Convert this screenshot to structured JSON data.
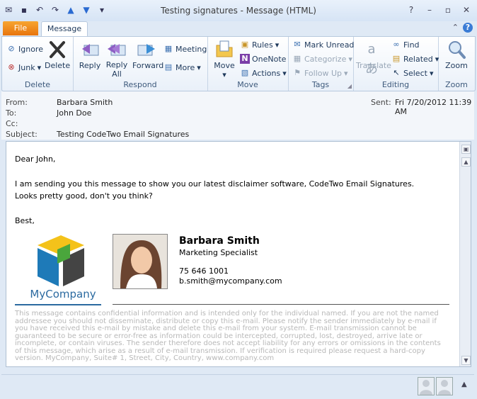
{
  "window": {
    "title": "Testing signatures  -  Message (HTML)",
    "qat_icons": [
      "mail-icon",
      "save-icon",
      "undo-icon",
      "redo-icon",
      "up-arrow-icon",
      "down-arrow-icon",
      "customize-icon"
    ]
  },
  "tabs": {
    "file": "File",
    "message": "Message"
  },
  "ribbon": {
    "delete_group": {
      "ignore": "Ignore",
      "junk": "Junk",
      "delete": "Delete",
      "label": "Delete"
    },
    "respond_group": {
      "reply": "Reply",
      "reply_all_1": "Reply",
      "reply_all_2": "All",
      "forward": "Forward",
      "meeting": "Meeting",
      "more": "More",
      "label": "Respond"
    },
    "move_group": {
      "move": "Move",
      "rules": "Rules",
      "onenote": "OneNote",
      "actions": "Actions",
      "label": "Move"
    },
    "tags_group": {
      "mark_unread": "Mark Unread",
      "categorize": "Categorize",
      "follow_up": "Follow Up",
      "label": "Tags"
    },
    "editing_group": {
      "translate": "Translate",
      "find": "Find",
      "related": "Related",
      "select": "Select",
      "label": "Editing"
    },
    "zoom_group": {
      "zoom": "Zoom",
      "label": "Zoom"
    }
  },
  "header": {
    "from_label": "From:",
    "from": "Barbara Smith",
    "to_label": "To:",
    "to": "John Doe",
    "cc_label": "Cc:",
    "cc": "",
    "subject_label": "Subject:",
    "subject": "Testing CodeTwo Email Signatures",
    "sent_label": "Sent:",
    "sent": "Fri 7/20/2012 11:39 AM"
  },
  "body": {
    "greeting": "Dear John,",
    "line1": "I am sending you this message to show you our latest disclaimer software, CodeTwo Email Signatures.",
    "line2": "Looks pretty good, don't you think?",
    "closing": "Best,"
  },
  "signature": {
    "company": "MyCompany",
    "name": "Barbara Smith",
    "role": "Marketing Specialist",
    "phone": "75 646 1001",
    "email": "b.smith@mycompany.com"
  },
  "disclaimer": "This message contains confidential information and is intended only for the individual named. If you are not the named addressee you should not disseminate, distribute or copy this e-mail. Please notify the sender immediately by e-mail if you have received this e-mail by mistake and delete this e-mail from your system. E-mail transmission cannot be guaranteed to be secure or error-free as information could be intercepted, corrupted, lost, destroyed, arrive late or incomplete, or contain viruses. The sender therefore does not accept liability for any errors or omissions in the contents of this message, which arise as a result of e-mail transmission. If verification is required please request a hard-copy version. MyCompany, Suite# 1, Street, City, Country, www.company.com",
  "colors": {
    "file_tab": "#e8740d",
    "accent": "#2b6aa0"
  }
}
